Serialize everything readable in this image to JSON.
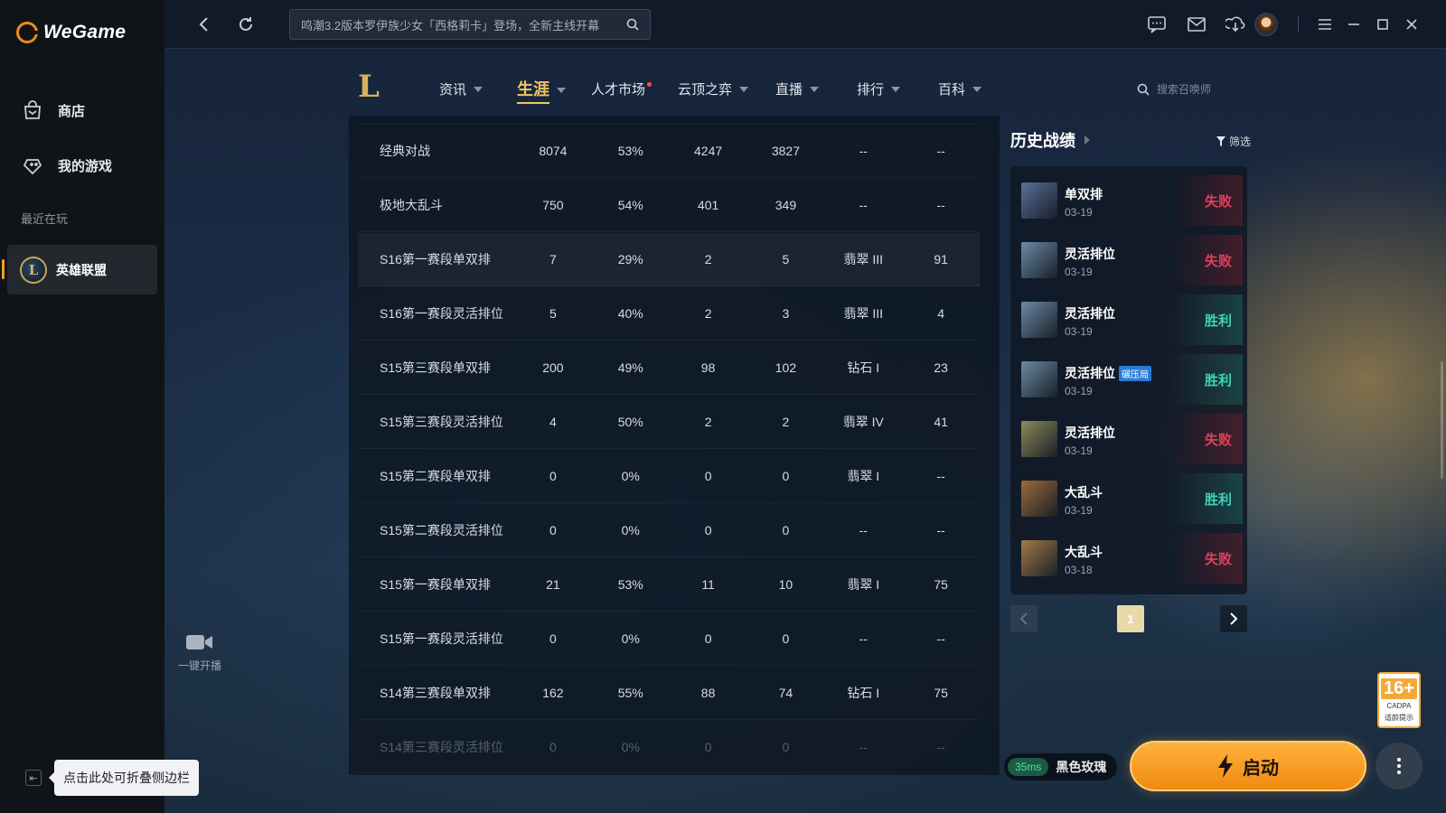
{
  "app": {
    "name": "WeGame"
  },
  "sidebar": {
    "items": [
      {
        "label": "商店",
        "icon": "store-icon"
      },
      {
        "label": "我的游戏",
        "icon": "gamepad-icon"
      }
    ],
    "recent_label": "最近在玩",
    "recent_game": "英雄联盟",
    "recent_game_icon_letter": "L",
    "stream_label": "一键开播",
    "collapse_tooltip": "点击此处可折叠侧边栏"
  },
  "topbar": {
    "search_text": "鸣潮3.2版本罗伊族少女「西格莉卡」登场，全新主线开幕"
  },
  "gamenav": {
    "logo_letter": "L",
    "tabs": [
      {
        "label": "资讯",
        "has_caret": true
      },
      {
        "label": "生涯",
        "has_caret": true,
        "active": true
      },
      {
        "label": "人才市场",
        "has_dot": true
      },
      {
        "label": "云顶之弈",
        "has_caret": true
      },
      {
        "label": "直播",
        "has_caret": true
      },
      {
        "label": "排行",
        "has_caret": true
      },
      {
        "label": "百科",
        "has_caret": true
      }
    ],
    "search_placeholder": "搜索召唤师"
  },
  "stats": {
    "rows": [
      [
        "经典对战",
        "8074",
        "53%",
        "4247",
        "3827",
        "--",
        "--"
      ],
      [
        "极地大乱斗",
        "750",
        "54%",
        "401",
        "349",
        "--",
        "--"
      ],
      [
        "S16第一赛段单双排",
        "7",
        "29%",
        "2",
        "5",
        "翡翠 III",
        "91"
      ],
      [
        "S16第一赛段灵活排位",
        "5",
        "40%",
        "2",
        "3",
        "翡翠 III",
        "4"
      ],
      [
        "S15第三赛段单双排",
        "200",
        "49%",
        "98",
        "102",
        "钻石 I",
        "23"
      ],
      [
        "S15第三赛段灵活排位",
        "4",
        "50%",
        "2",
        "2",
        "翡翠 IV",
        "41"
      ],
      [
        "S15第二赛段单双排",
        "0",
        "0%",
        "0",
        "0",
        "翡翠 I",
        "--"
      ],
      [
        "S15第二赛段灵活排位",
        "0",
        "0%",
        "0",
        "0",
        "--",
        "--"
      ],
      [
        "S15第一赛段单双排",
        "21",
        "53%",
        "11",
        "10",
        "翡翠 I",
        "75"
      ],
      [
        "S15第一赛段灵活排位",
        "0",
        "0%",
        "0",
        "0",
        "--",
        "--"
      ],
      [
        "S14第三赛段单双排",
        "162",
        "55%",
        "88",
        "74",
        "钻石 I",
        "75"
      ],
      [
        "S14第三赛段灵活排位",
        "0",
        "0%",
        "0",
        "0",
        "--",
        "--"
      ]
    ]
  },
  "history": {
    "title": "历史战绩",
    "filter_label": "筛选",
    "matches": [
      {
        "mode": "单双排",
        "date": "03-19",
        "result": "失败",
        "win": false,
        "tag": "",
        "color": "#5a6f9a"
      },
      {
        "mode": "灵活排位",
        "date": "03-19",
        "result": "失败",
        "win": false,
        "tag": "",
        "color": "#6a8aa5"
      },
      {
        "mode": "灵活排位",
        "date": "03-19",
        "result": "胜利",
        "win": true,
        "tag": "",
        "color": "#6a8aa5"
      },
      {
        "mode": "灵活排位",
        "date": "03-19",
        "result": "胜利",
        "win": true,
        "tag": "碾压局",
        "color": "#6a8aa5"
      },
      {
        "mode": "灵活排位",
        "date": "03-19",
        "result": "失败",
        "win": false,
        "tag": "",
        "color": "#8c8a5a"
      },
      {
        "mode": "大乱斗",
        "date": "03-19",
        "result": "胜利",
        "win": true,
        "tag": "",
        "color": "#9a6a3a"
      },
      {
        "mode": "大乱斗",
        "date": "03-18",
        "result": "失败",
        "win": false,
        "tag": "",
        "color": "#a07a4a"
      }
    ],
    "page": "1"
  },
  "bottom": {
    "ping": "35ms",
    "region": "黑色玫瑰",
    "launch_label": "启动",
    "age_rating": "16+",
    "age_brand": "CADPA",
    "age_sub": "适龄提示"
  }
}
